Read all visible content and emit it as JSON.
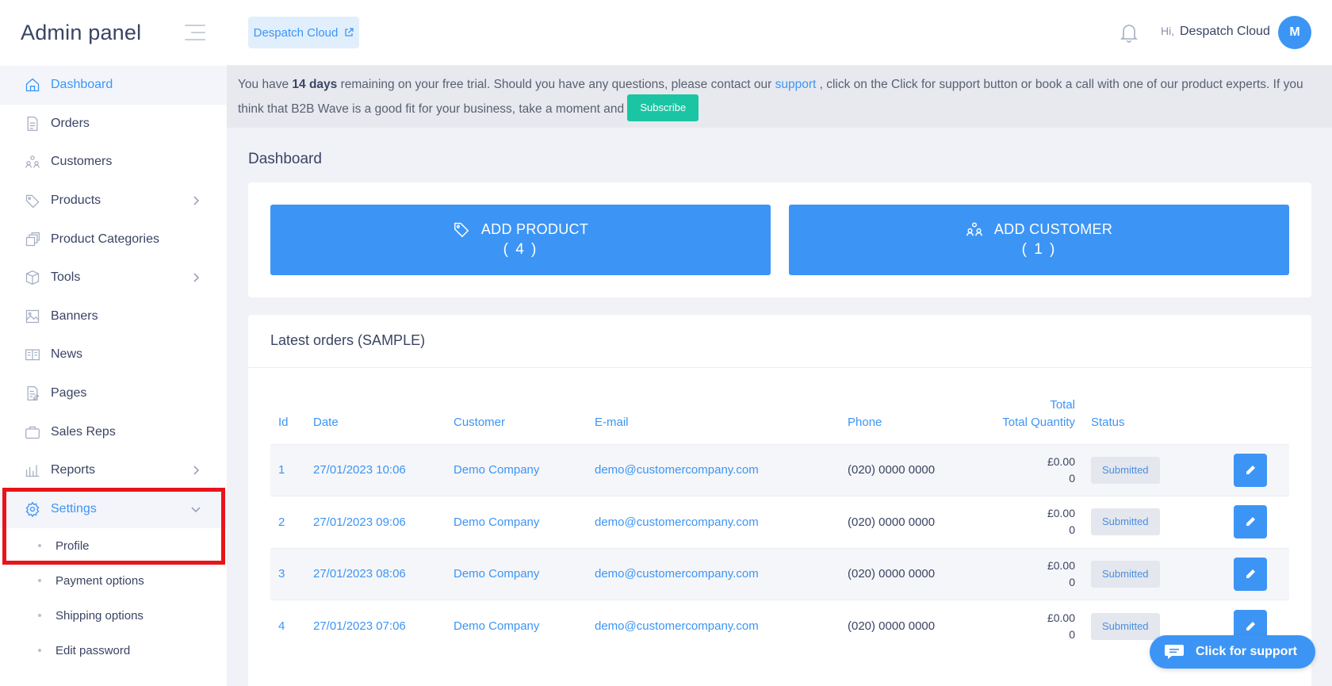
{
  "brand": {
    "title": "Admin panel"
  },
  "sidebar": {
    "items": [
      {
        "label": "Dashboard",
        "icon": "home-icon"
      },
      {
        "label": "Orders",
        "icon": "document-icon"
      },
      {
        "label": "Customers",
        "icon": "users-icon"
      },
      {
        "label": "Products",
        "icon": "tag-icon"
      },
      {
        "label": "Product Categories",
        "icon": "categories-icon"
      },
      {
        "label": "Tools",
        "icon": "box-icon"
      },
      {
        "label": "Banners",
        "icon": "image-icon"
      },
      {
        "label": "News",
        "icon": "newspaper-icon"
      },
      {
        "label": "Pages",
        "icon": "pages-icon"
      },
      {
        "label": "Sales Reps",
        "icon": "briefcase-icon"
      },
      {
        "label": "Reports",
        "icon": "bar-chart-icon"
      },
      {
        "label": "Settings",
        "icon": "gear-icon"
      }
    ],
    "settings_sub": [
      {
        "label": "Profile"
      },
      {
        "label": "Payment options"
      },
      {
        "label": "Shipping options"
      },
      {
        "label": "Edit password"
      }
    ]
  },
  "header": {
    "site_button": "Despatch Cloud",
    "greeting": "Hi,",
    "user_name": "Despatch Cloud",
    "avatar_initial": "M"
  },
  "trial": {
    "text_1": "You have ",
    "days": "14 days",
    "text_2": " remaining on your free trial. Should you have any questions, please contact our ",
    "support_link": "support",
    "text_3": " , click on the Click for support button or book a call with one of our product experts. If you think that B2B Wave is a good fit for your business, take a moment and ",
    "subscribe": "Subscribe"
  },
  "main": {
    "title": "Dashboard",
    "add_product": {
      "label": "ADD PRODUCT",
      "count": "( 4 )"
    },
    "add_customer": {
      "label": "ADD CUSTOMER",
      "count": "( 1 )"
    }
  },
  "orders": {
    "title": "Latest orders (SAMPLE)",
    "headers": {
      "id": "Id",
      "date": "Date",
      "customer": "Customer",
      "email": "E-mail",
      "phone": "Phone",
      "total": "Total",
      "total_quantity": "Total Quantity",
      "status": "Status"
    },
    "rows": [
      {
        "id": "1",
        "date": "27/01/2023 10:06",
        "customer": "Demo Company",
        "email": "demo@customercompany.com",
        "phone": "(020) 0000 0000",
        "total": "£0.00",
        "qty": "0",
        "status": "Submitted"
      },
      {
        "id": "2",
        "date": "27/01/2023 09:06",
        "customer": "Demo Company",
        "email": "demo@customercompany.com",
        "phone": "(020) 0000 0000",
        "total": "£0.00",
        "qty": "0",
        "status": "Submitted"
      },
      {
        "id": "3",
        "date": "27/01/2023 08:06",
        "customer": "Demo Company",
        "email": "demo@customercompany.com",
        "phone": "(020) 0000 0000",
        "total": "£0.00",
        "qty": "0",
        "status": "Submitted"
      },
      {
        "id": "4",
        "date": "27/01/2023 07:06",
        "customer": "Demo Company",
        "email": "demo@customercompany.com",
        "phone": "(020) 0000 0000",
        "total": "£0.00",
        "qty": "0",
        "status": "Submitted"
      }
    ]
  },
  "support_button": "Click for support",
  "colors": {
    "accent": "#3c95f5",
    "subscribe": "#1bc5a3",
    "highlight": "#e8141a"
  }
}
